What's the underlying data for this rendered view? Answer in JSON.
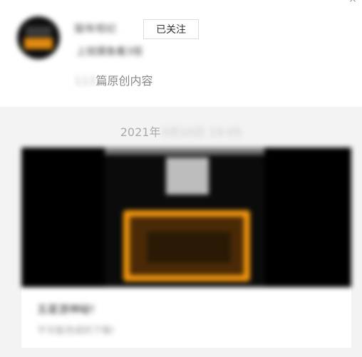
{
  "header": {
    "account_name": "猫咪相纪",
    "follow_label": "已关注",
    "description": "上班摸鱼看3视",
    "article_count": "113",
    "article_suffix": "篇原创内容"
  },
  "feed": {
    "date_year": "2021年",
    "date_rest": "3月10日 19:05",
    "card": {
      "title": "五星游神秘!",
      "subtitle": "不可能完成的下载!"
    }
  },
  "colors": {
    "accent_orange": "#f0960e",
    "feed_background": "#f3f3f3",
    "muted_text": "#aaaaaa"
  },
  "icons": {
    "close": "close-icon"
  }
}
